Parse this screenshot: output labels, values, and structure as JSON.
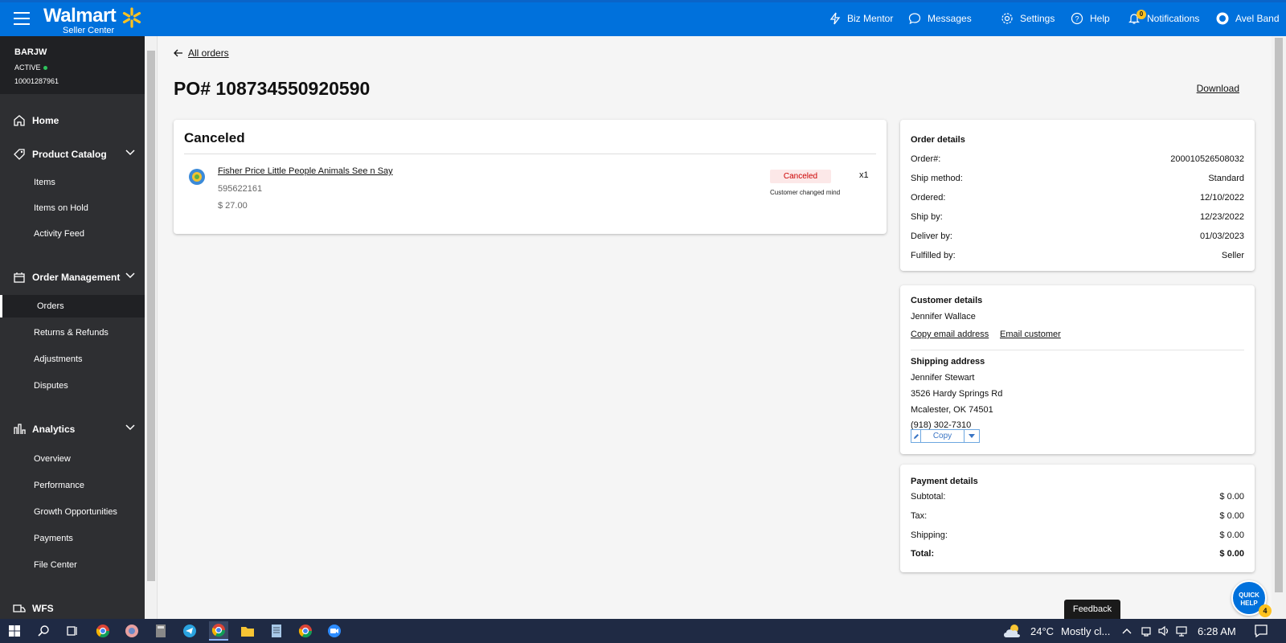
{
  "topbar": {
    "logo": "Walmart",
    "logo_sub": "Seller Center",
    "nav": [
      {
        "label": "Biz Mentor",
        "icon": "bolt-icon"
      },
      {
        "label": "Messages",
        "icon": "chat-icon"
      },
      {
        "label": "Settings",
        "icon": "gear-icon"
      },
      {
        "label": "Help",
        "icon": "help-icon"
      },
      {
        "label": "Notifications",
        "icon": "bell-icon",
        "badge": "0"
      },
      {
        "label": "Avel Band",
        "icon": "avatar-icon"
      }
    ]
  },
  "sidebar": {
    "account_name": "BARJW",
    "account_status": "ACTIVE",
    "account_id": "10001287961",
    "home": "Home",
    "product_catalog": {
      "label": "Product Catalog",
      "items": [
        "Items",
        "Items on Hold",
        "Activity Feed"
      ]
    },
    "order_management": {
      "label": "Order Management",
      "items": [
        "Orders",
        "Returns & Refunds",
        "Adjustments",
        "Disputes"
      ]
    },
    "analytics": {
      "label": "Analytics",
      "items": [
        "Overview",
        "Performance",
        "Growth Opportunities",
        "Payments",
        "File Center"
      ]
    },
    "wfs": "WFS"
  },
  "main": {
    "back_link": "All orders",
    "po_title": "PO# 108734550920590",
    "download": "Download",
    "status_card": {
      "title": "Canceled",
      "product_name": "Fisher Price Little People Animals See n Say",
      "sku": "595622161",
      "price": "$ 27.00",
      "status_badge": "Canceled",
      "reason": "Customer changed mind",
      "qty": "x1"
    },
    "order_details": {
      "title": "Order details",
      "rows": [
        {
          "label": "Order#:",
          "value": "200010526508032"
        },
        {
          "label": "Ship method:",
          "value": "Standard"
        },
        {
          "label": "Ordered:",
          "value": "12/10/2022"
        },
        {
          "label": "Ship by:",
          "value": "12/23/2022"
        },
        {
          "label": "Deliver by:",
          "value": "01/03/2023"
        },
        {
          "label": "Fulfilled by:",
          "value": "Seller"
        }
      ]
    },
    "customer_details": {
      "title": "Customer details",
      "name": "Jennifer Wallace",
      "copy_email": "Copy email address",
      "email_customer": "Email customer",
      "shipping_title": "Shipping address",
      "ship_name": "Jennifer Stewart",
      "ship_street": "3526 Hardy Springs Rd",
      "ship_city": "Mcalester, OK 74501",
      "ship_phone": "(918) 302-7310",
      "copy_button": "Copy"
    },
    "payment_details": {
      "title": "Payment details",
      "rows": [
        {
          "label": "Subtotal:",
          "value": "$ 0.00"
        },
        {
          "label": "Tax:",
          "value": "$ 0.00"
        },
        {
          "label": "Shipping:",
          "value": "$ 0.00"
        },
        {
          "label": "Total:",
          "value": "$ 0.00"
        }
      ]
    },
    "feedback": "Feedback",
    "quick_help": "QUICK HELP",
    "quick_help_badge": "4"
  },
  "taskbar": {
    "weather_temp": "24°C",
    "weather_desc": "Mostly cl...",
    "time": "6:28 AM"
  },
  "colors": {
    "brand_blue": "#0071dc",
    "spark_yellow": "#ffc220",
    "sidebar": "#2e2f32",
    "canceled_red": "#c00"
  }
}
